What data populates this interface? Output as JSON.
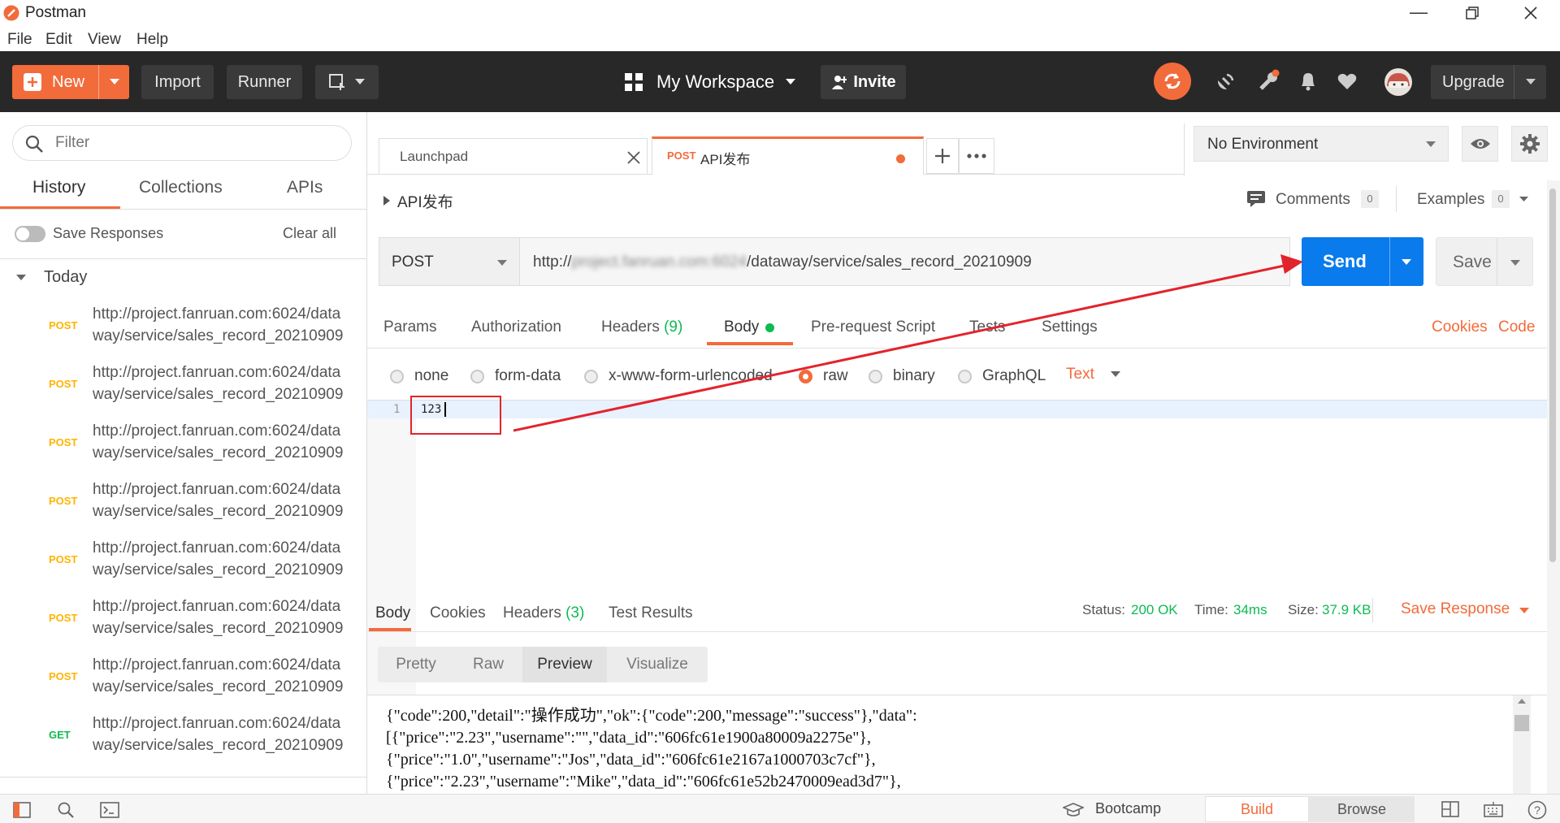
{
  "app": {
    "title": "Postman"
  },
  "menu": [
    "File",
    "Edit",
    "View",
    "Help"
  ],
  "toolbar": {
    "new_label": "New",
    "import_label": "Import",
    "runner_label": "Runner",
    "workspace_label": "My Workspace",
    "invite_label": "Invite",
    "upgrade_label": "Upgrade"
  },
  "sidebar": {
    "filter_placeholder": "Filter",
    "tabs": [
      "History",
      "Collections",
      "APIs"
    ],
    "save_responses_label": "Save Responses",
    "clear_all_label": "Clear all",
    "group_label": "Today",
    "items": [
      {
        "method": "POST",
        "url": "http://project.fanruan.com:6024/dataway/service/sales_record_20210909",
        "line1": "http://project.fanruan.com:6024/data",
        "line2": "way/service/sales_record_20210909"
      },
      {
        "method": "POST",
        "url": "http://project.fanruan.com:6024/dataway/service/sales_record_20210909",
        "line1": "http://project.fanruan.com:6024/data",
        "line2": "way/service/sales_record_20210909"
      },
      {
        "method": "POST",
        "url": "http://project.fanruan.com:6024/dataway/service/sales_record_20210909",
        "line1": "http://project.fanruan.com:6024/data",
        "line2": "way/service/sales_record_20210909"
      },
      {
        "method": "POST",
        "url": "http://project.fanruan.com:6024/dataway/service/sales_record_20210909",
        "line1": "http://project.fanruan.com:6024/data",
        "line2": "way/service/sales_record_20210909"
      },
      {
        "method": "POST",
        "url": "http://project.fanruan.com:6024/dataway/service/sales_record_20210909",
        "line1": "http://project.fanruan.com:6024/data",
        "line2": "way/service/sales_record_20210909"
      },
      {
        "method": "POST",
        "url": "http://project.fanruan.com:6024/dataway/service/sales_record_20210909",
        "line1": "http://project.fanruan.com:6024/data",
        "line2": "way/service/sales_record_20210909"
      },
      {
        "method": "POST",
        "url": "http://project.fanruan.com:6024/dataway/service/sales_record_20210909",
        "line1": "http://project.fanruan.com:6024/data",
        "line2": "way/service/sales_record_20210909"
      },
      {
        "method": "GET",
        "url": "http://project.fanruan.com:6024/dataway/service/sales_record_20210909",
        "line1": "http://project.fanruan.com:6024/data",
        "line2": "way/service/sales_record_20210909"
      }
    ]
  },
  "tabs": {
    "launchpad_label": "Launchpad",
    "active_method": "POST",
    "active_name": "API发布"
  },
  "environment": {
    "selected": "No Environment"
  },
  "request": {
    "name": "API发布",
    "comments_label": "Comments",
    "comments_count": "0",
    "examples_label": "Examples",
    "examples_count": "0",
    "method": "POST",
    "url_prefix": "http://",
    "url_blurred": "project.fanruan.com:6024",
    "url_suffix": "/dataway/service/sales_record_20210909",
    "send_label": "Send",
    "save_label": "Save",
    "subtabs": {
      "params": "Params",
      "authorization": "Authorization",
      "headers": "Headers",
      "headers_count": "(9)",
      "body": "Body",
      "prerequest": "Pre-request Script",
      "tests": "Tests",
      "settings": "Settings",
      "cookies": "Cookies",
      "code": "Code"
    },
    "body_types": {
      "none": "none",
      "form_data": "form-data",
      "urlencoded": "x-www-form-urlencoded",
      "raw": "raw",
      "binary": "binary",
      "graphql": "GraphQL",
      "format": "Text"
    },
    "editor": {
      "line_number": "1",
      "content": "123"
    }
  },
  "response": {
    "tabs": {
      "body": "Body",
      "cookies": "Cookies",
      "headers": "Headers",
      "headers_count": "(3)",
      "tests": "Test Results"
    },
    "status_label": "Status:",
    "status_value": "200 OK",
    "time_label": "Time:",
    "time_value": "34ms",
    "size_label": "Size:",
    "size_value": "37.9 KB",
    "save_label": "Save Response",
    "view_modes": [
      "Pretty",
      "Raw",
      "Preview",
      "Visualize"
    ],
    "lines": [
      "{\"code\":200,\"detail\":\"操作成功\",\"ok\":{\"code\":200,\"message\":\"success\"},\"data\":",
      "[{\"price\":\"2.23\",\"username\":\"\",\"data_id\":\"606fc61e1900a80009a2275e\"},",
      "{\"price\":\"1.0\",\"username\":\"Jos\",\"data_id\":\"606fc61e2167a1000703c7cf\"},",
      "{\"price\":\"2.23\",\"username\":\"Mike\",\"data_id\":\"606fc61e52b2470009ead3d7\"},"
    ]
  },
  "statusbar": {
    "bootcamp_label": "Bootcamp",
    "build_label": "Build",
    "browse_label": "Browse"
  },
  "colors": {
    "accent": "#f26b3a",
    "send_blue": "#097bed",
    "dark_bar": "#282828",
    "ok_green": "#0cbb52",
    "annotation_red": "#e3232c"
  }
}
